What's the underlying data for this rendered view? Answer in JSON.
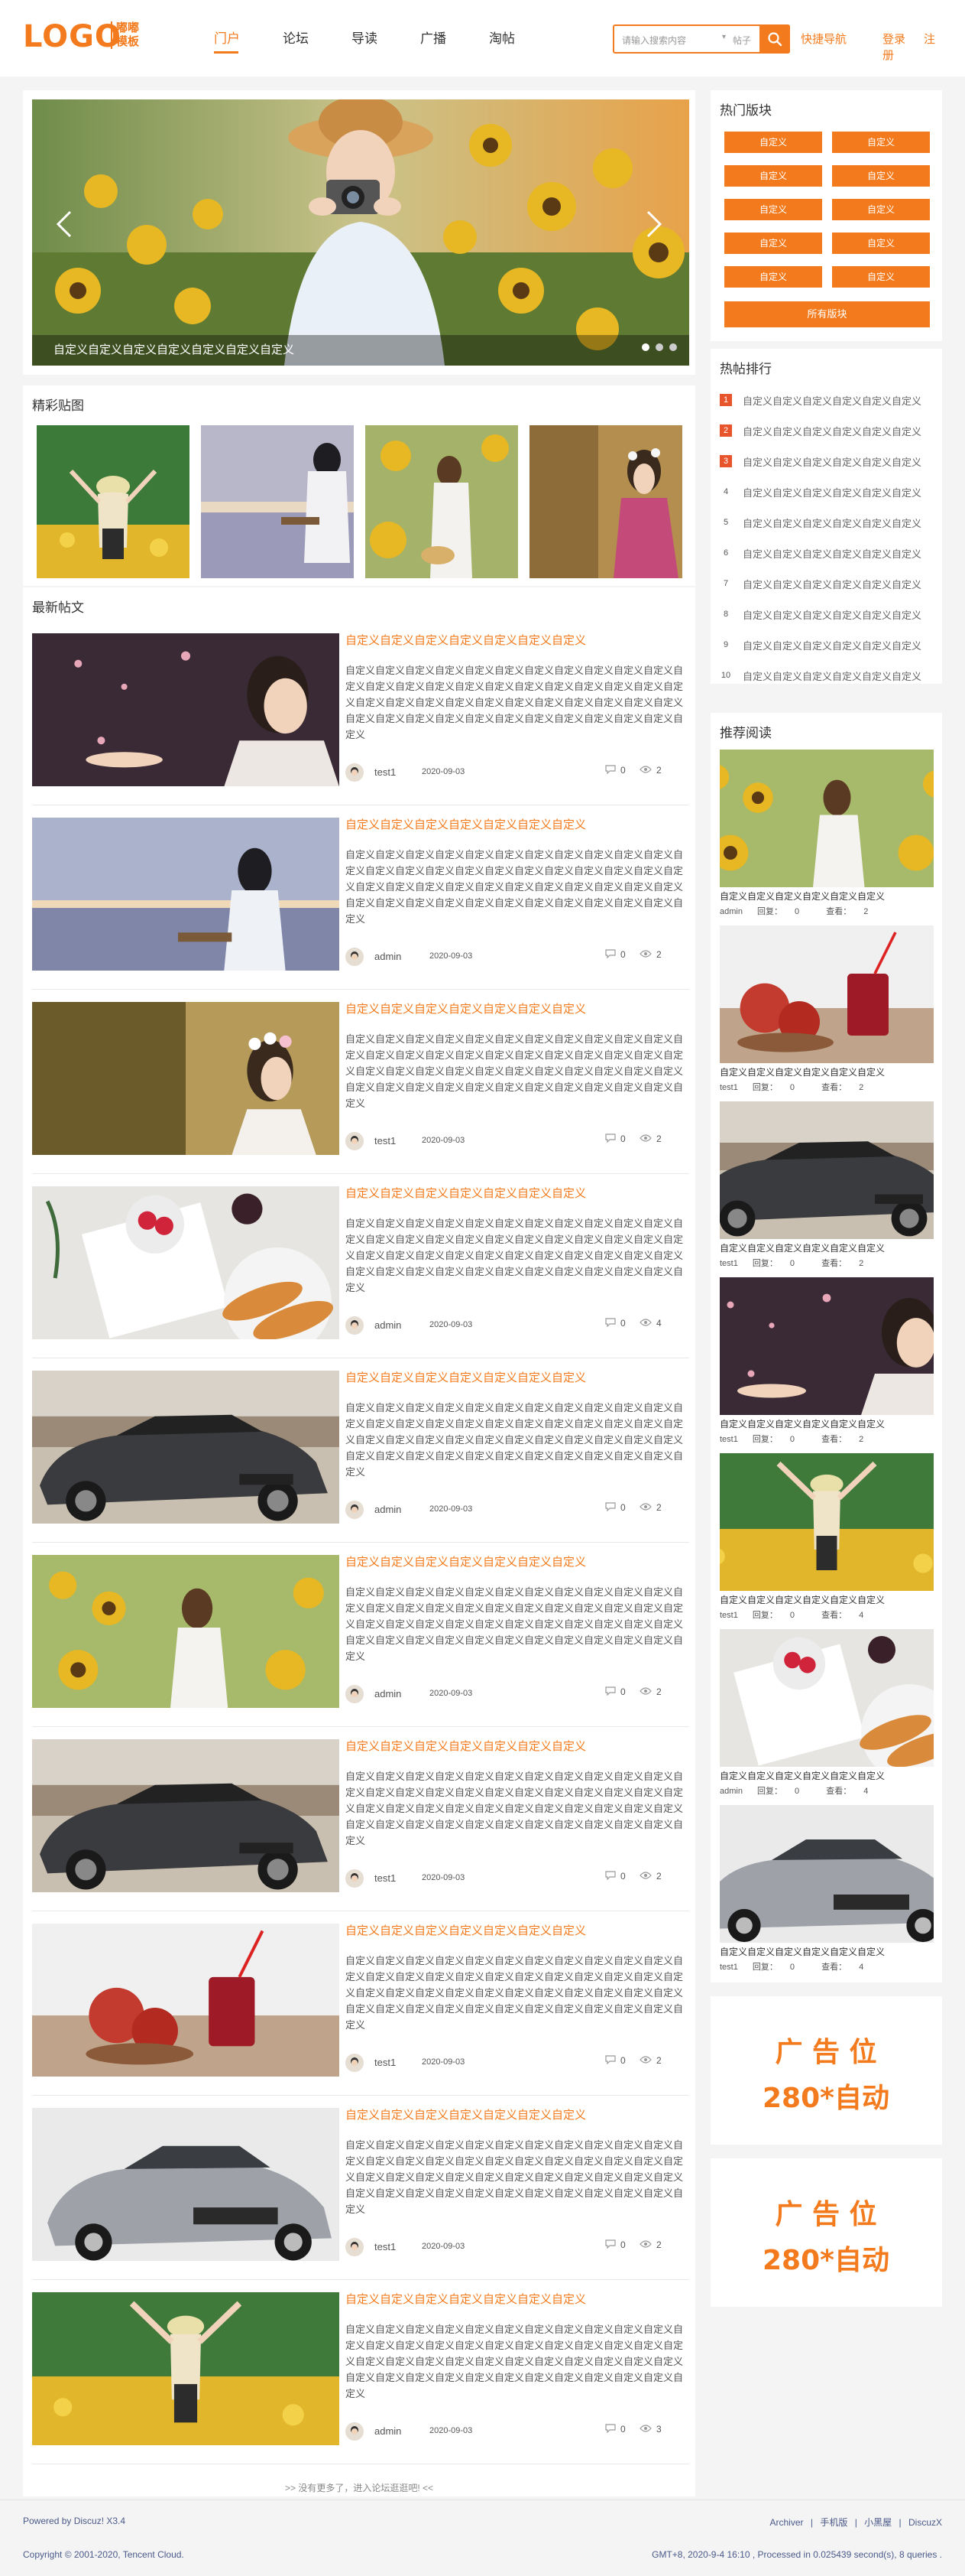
{
  "header": {
    "logo": "LOGO",
    "logo_sub": "嘟嘟模板",
    "nav": [
      "门户",
      "论坛",
      "导读",
      "广播",
      "淘帖"
    ],
    "search_placeholder": "请输入搜索内容",
    "search_scope": "帖子",
    "quick_nav": "快捷导航",
    "login": "登录",
    "register": "注册"
  },
  "slider": {
    "caption": "自定义自定义自定义自定义自定义自定义自定义",
    "dot_count": 3,
    "active_dot": 1
  },
  "featured": {
    "title": "精彩贴图"
  },
  "latest": {
    "title": "最新帖文",
    "more": ">> 没有更多了，进入论坛逛逛吧! <<",
    "posts": [
      {
        "title": "自定义自定义自定义自定义自定义自定义自定义",
        "body": "自定义自定义自定义自定义自定义自定义自定义自定义自定义自定义自定义自定义自定义自定义自定义自定义自定义自定义自定义自定义自定义自定义自定义自定义自定义自定义自定义自定义自定义自定义自定义自定义自定义自定义自定义自定义自定义自定义自定义自定义自定义自定义自定义自定义自定义自定义",
        "author": "test1",
        "date": "2020-09-03",
        "replies": "0",
        "views": "2",
        "img": "petals"
      },
      {
        "title": "自定义自定义自定义自定义自定义自定义自定义",
        "body": "自定义自定义自定义自定义自定义自定义自定义自定义自定义自定义自定义自定义自定义自定义自定义自定义自定义自定义自定义自定义自定义自定义自定义自定义自定义自定义自定义自定义自定义自定义自定义自定义自定义自定义自定义自定义自定义自定义自定义自定义自定义自定义自定义自定义自定义自定义",
        "author": "admin",
        "date": "2020-09-03",
        "replies": "0",
        "views": "2",
        "img": "ukulele"
      },
      {
        "title": "自定义自定义自定义自定义自定义自定义自定义",
        "body": "自定义自定义自定义自定义自定义自定义自定义自定义自定义自定义自定义自定义自定义自定义自定义自定义自定义自定义自定义自定义自定义自定义自定义自定义自定义自定义自定义自定义自定义自定义自定义自定义自定义自定义自定义自定义自定义自定义自定义自定义自定义自定义自定义自定义自定义自定义",
        "author": "test1",
        "date": "2020-09-03",
        "replies": "0",
        "views": "2",
        "img": "flowercrown"
      },
      {
        "title": "自定义自定义自定义自定义自定义自定义自定义",
        "body": "自定义自定义自定义自定义自定义自定义自定义自定义自定义自定义自定义自定义自定义自定义自定义自定义自定义自定义自定义自定义自定义自定义自定义自定义自定义自定义自定义自定义自定义自定义自定义自定义自定义自定义自定义自定义自定义自定义自定义自定义自定义自定义自定义自定义自定义自定义",
        "author": "admin",
        "date": "2020-09-03",
        "replies": "0",
        "views": "4",
        "img": "breakfast"
      },
      {
        "title": "自定义自定义自定义自定义自定义自定义自定义",
        "body": "自定义自定义自定义自定义自定义自定义自定义自定义自定义自定义自定义自定义自定义自定义自定义自定义自定义自定义自定义自定义自定义自定义自定义自定义自定义自定义自定义自定义自定义自定义自定义自定义自定义自定义自定义自定义自定义自定义自定义自定义自定义自定义自定义自定义自定义自定义",
        "author": "admin",
        "date": "2020-09-03",
        "replies": "0",
        "views": "2",
        "img": "car"
      },
      {
        "title": "自定义自定义自定义自定义自定义自定义自定义",
        "body": "自定义自定义自定义自定义自定义自定义自定义自定义自定义自定义自定义自定义自定义自定义自定义自定义自定义自定义自定义自定义自定义自定义自定义自定义自定义自定义自定义自定义自定义自定义自定义自定义自定义自定义自定义自定义自定义自定义自定义自定义自定义自定义自定义自定义自定义自定义",
        "author": "admin",
        "date": "2020-09-03",
        "replies": "0",
        "views": "2",
        "img": "sunflower"
      },
      {
        "title": "自定义自定义自定义自定义自定义自定义自定义",
        "body": "自定义自定义自定义自定义自定义自定义自定义自定义自定义自定义自定义自定义自定义自定义自定义自定义自定义自定义自定义自定义自定义自定义自定义自定义自定义自定义自定义自定义自定义自定义自定义自定义自定义自定义自定义自定义自定义自定义自定义自定义自定义自定义自定义自定义自定义自定义",
        "author": "test1",
        "date": "2020-09-03",
        "replies": "0",
        "views": "2",
        "img": "car"
      },
      {
        "title": "自定义自定义自定义自定义自定义自定义自定义",
        "body": "自定义自定义自定义自定义自定义自定义自定义自定义自定义自定义自定义自定义自定义自定义自定义自定义自定义自定义自定义自定义自定义自定义自定义自定义自定义自定义自定义自定义自定义自定义自定义自定义自定义自定义自定义自定义自定义自定义自定义自定义自定义自定义自定义自定义自定义自定义",
        "author": "test1",
        "date": "2020-09-03",
        "replies": "0",
        "views": "2",
        "img": "drink"
      },
      {
        "title": "自定义自定义自定义自定义自定义自定义自定义",
        "body": "自定义自定义自定义自定义自定义自定义自定义自定义自定义自定义自定义自定义自定义自定义自定义自定义自定义自定义自定义自定义自定义自定义自定义自定义自定义自定义自定义自定义自定义自定义自定义自定义自定义自定义自定义自定义自定义自定义自定义自定义自定义自定义自定义自定义自定义自定义",
        "author": "test1",
        "date": "2020-09-03",
        "replies": "0",
        "views": "2",
        "img": "silvercar"
      },
      {
        "title": "自定义自定义自定义自定义自定义自定义自定义",
        "body": "自定义自定义自定义自定义自定义自定义自定义自定义自定义自定义自定义自定义自定义自定义自定义自定义自定义自定义自定义自定义自定义自定义自定义自定义自定义自定义自定义自定义自定义自定义自定义自定义自定义自定义自定义自定义自定义自定义自定义自定义自定义自定义自定义自定义自定义自定义",
        "author": "admin",
        "date": "2020-09-03",
        "replies": "0",
        "views": "3",
        "img": "flowerfield"
      }
    ]
  },
  "hot_forums": {
    "title": "热门版块",
    "items": [
      "自定义",
      "自定义",
      "自定义",
      "自定义",
      "自定义",
      "自定义",
      "自定义",
      "自定义",
      "自定义",
      "自定义"
    ],
    "all_label": "所有版块"
  },
  "hot_rank": {
    "title": "热帖排行",
    "items": [
      {
        "num": "1",
        "text": "自定义自定义自定义自定义自定义自定义"
      },
      {
        "num": "2",
        "text": "自定义自定义自定义自定义自定义自定义"
      },
      {
        "num": "3",
        "text": "自定义自定义自定义自定义自定义自定义"
      },
      {
        "num": "4",
        "text": "自定义自定义自定义自定义自定义自定义"
      },
      {
        "num": "5",
        "text": "自定义自定义自定义自定义自定义自定义"
      },
      {
        "num": "6",
        "text": "自定义自定义自定义自定义自定义自定义"
      },
      {
        "num": "7",
        "text": "自定义自定义自定义自定义自定义自定义"
      },
      {
        "num": "8",
        "text": "自定义自定义自定义自定义自定义自定义"
      },
      {
        "num": "9",
        "text": "自定义自定义自定义自定义自定义自定义"
      },
      {
        "num": "10",
        "text": "自定义自定义自定义自定义自定义自定义"
      }
    ]
  },
  "recommended": {
    "title": "推荐阅读",
    "reply_label": "回复：",
    "view_label": "查看：",
    "items": [
      {
        "title": "自定义自定义自定义自定义自定义自定义",
        "author": "admin",
        "replies": "0",
        "views": "2",
        "img": "sunflower"
      },
      {
        "title": "自定义自定义自定义自定义自定义自定义",
        "author": "test1",
        "replies": "0",
        "views": "2",
        "img": "drink"
      },
      {
        "title": "自定义自定义自定义自定义自定义自定义",
        "author": "test1",
        "replies": "0",
        "views": "2",
        "img": "car"
      },
      {
        "title": "自定义自定义自定义自定义自定义自定义",
        "author": "test1",
        "replies": "0",
        "views": "2",
        "img": "petals"
      },
      {
        "title": "自定义自定义自定义自定义自定义自定义",
        "author": "test1",
        "replies": "0",
        "views": "4",
        "img": "flowerfield"
      },
      {
        "title": "自定义自定义自定义自定义自定义自定义",
        "author": "admin",
        "replies": "0",
        "views": "4",
        "img": "breakfast"
      },
      {
        "title": "自定义自定义自定义自定义自定义自定义",
        "author": "test1",
        "replies": "0",
        "views": "4",
        "img": "silvercar"
      }
    ]
  },
  "ads": [
    {
      "line1": "广 告 位",
      "line2": "280*自动"
    },
    {
      "line1": "广 告 位",
      "line2": "280*自动"
    }
  ],
  "footer": {
    "powered": "Powered by Discuz! X3.4",
    "copyright": "Copyright © 2001-2020, Tencent Cloud.",
    "links": [
      "Archiver",
      "|",
      "手机版",
      "|",
      "小黑屋",
      "|",
      "DiscuzX"
    ],
    "stats": "GMT+8, 2020-9-4 16:10 , Processed in 0.025439 second(s), 8 queries ."
  },
  "colors": {
    "accent": "#f37b1d",
    "rank_top": "#e8542c",
    "bg": "#f4f4f4"
  }
}
